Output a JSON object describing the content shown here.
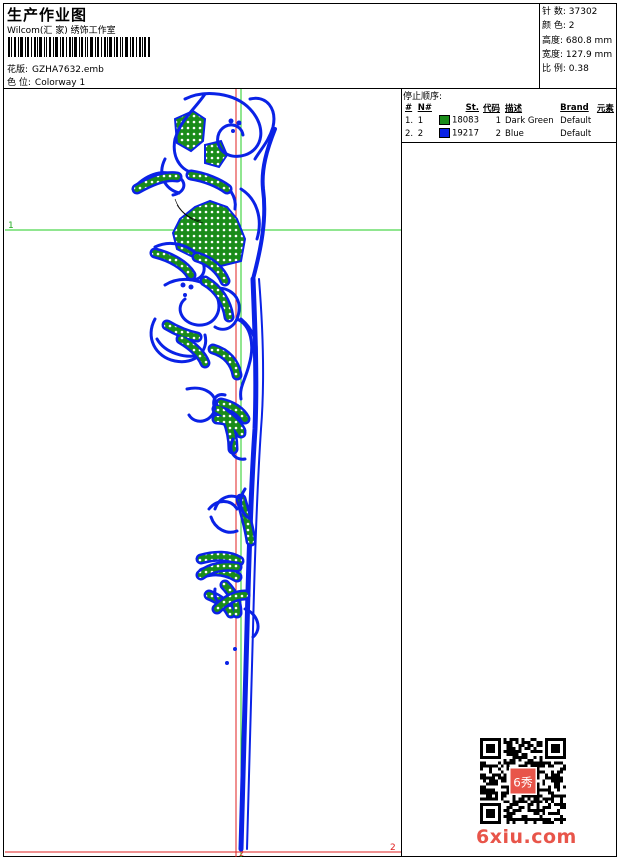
{
  "header": {
    "title": "生产作业图",
    "studio": "Wilcom(汇 家) 绣饰工作室",
    "design_label": "花版:",
    "design_value": "GZHA7632.emb",
    "colorway_label": "色 位:",
    "colorway_value": "Colorway 1"
  },
  "stats": {
    "stitches_label": "针 数:",
    "stitches_value": "37302",
    "colors_label": "颜 色:",
    "colors_value": "2",
    "height_label": "高度:",
    "height_value": "680.8 mm",
    "width_label": "宽度:",
    "width_value": "127.9 mm",
    "scale_label": "比 例:",
    "scale_value": "0.38"
  },
  "canvas": {
    "marker_1": "1",
    "marker_2_right": "2",
    "marker_2_bottom": "2"
  },
  "stop_sequence": {
    "title": "停止顺序:",
    "columns": [
      "#",
      "N#",
      "St.",
      "代码",
      "描述",
      "Brand",
      "元素"
    ],
    "rows": [
      {
        "index": "1.",
        "n": "1",
        "swatch": "#1a8c1a",
        "stitches": "18083",
        "code": "1",
        "desc": "Dark Green",
        "brand": "Default"
      },
      {
        "index": "2.",
        "n": "2",
        "swatch": "#0a22e6",
        "stitches": "19217",
        "code": "2",
        "desc": "Blue",
        "brand": "Default"
      }
    ]
  },
  "colors": {
    "embroidery_blue": "#0a22e6",
    "embroidery_green": "#1a8c1a",
    "guide_green": "#22cc22",
    "guide_red": "#e02020"
  },
  "watermark": {
    "site": "6xiu.com",
    "seal_text": "6秀"
  }
}
